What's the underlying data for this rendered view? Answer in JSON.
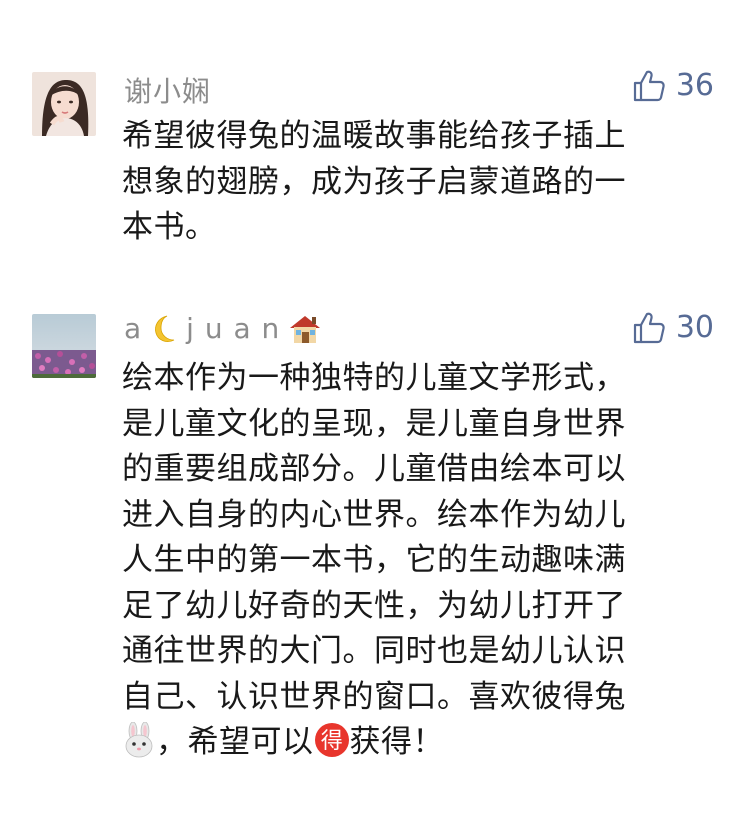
{
  "comments": [
    {
      "user": "谢小娴",
      "likes": "36",
      "text_lines": [
        "希望彼得兔的温暖故事能给孩子插上",
        "想象的翅膀，成为孩子启蒙道路的一",
        "本书。"
      ]
    },
    {
      "user": "a🌙juan🏠",
      "user_parts": [
        "a",
        "j u a n"
      ],
      "likes": "30",
      "text_lines": [
        "绘本作为一种独特的儿童文学形式，",
        "是儿童文化的呈现，是儿童自身世界",
        "的重要组成部分。儿童借由绘本可以",
        "进入自身的内心世界。绘本作为幼儿",
        "人生中的第一本书，它的生动趣味满",
        "足了幼儿好奇的天性，为幼儿打开了",
        "通往世界的大门。同时也是幼儿认识",
        "自己、认识世界的窗口。喜欢彼得兔"
      ],
      "last_line": "，希望可以",
      "badge_char": "得",
      "last_line_end": "获得！"
    }
  ],
  "icons": {
    "like": "thumbs-up-icon",
    "moon": "crescent-moon-icon",
    "house": "house-icon",
    "rabbit": "rabbit-face-icon",
    "badge": "circled-de-badge-icon"
  },
  "colors": {
    "link_blue": "#576b95",
    "name_gray": "#8c8c8c",
    "text": "#191919",
    "badge_red": "#e8352c"
  }
}
